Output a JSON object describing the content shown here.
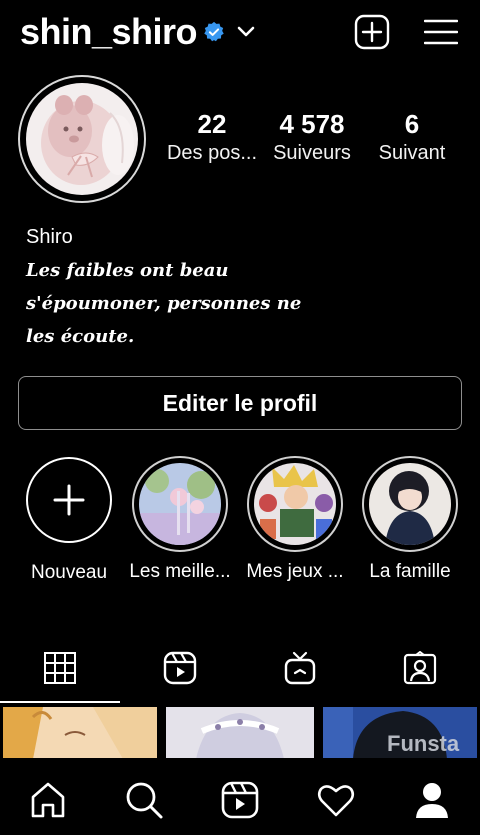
{
  "header": {
    "username": "shin_shiro",
    "icons": [
      "verified-badge-icon",
      "chevron-down-icon",
      "add-post-icon",
      "menu-icon"
    ]
  },
  "stats": [
    {
      "num": "22",
      "label": "Des pos..."
    },
    {
      "num": "4 578",
      "label": "Suiveurs"
    },
    {
      "num": "6",
      "label": "Suivant"
    }
  ],
  "profile": {
    "name": "Shiro",
    "bio_lines": [
      "Les faibles ont beau",
      "s'époumoner, personnes ne",
      "les écoute."
    ]
  },
  "edit_button": "Editer le profil",
  "highlights": [
    {
      "label": "Nouveau"
    },
    {
      "label": "Les meille..."
    },
    {
      "label": "Mes jeux ..."
    },
    {
      "label": "La famille"
    }
  ],
  "tabs": [
    "grid-icon",
    "reels-icon",
    "igtv-icon",
    "tagged-icon"
  ],
  "posts": {
    "watermark": "Funsta"
  },
  "nav": [
    "home-icon",
    "search-icon",
    "reels-icon",
    "heart-icon",
    "profile-icon"
  ],
  "colors": {
    "background": "#000000",
    "verified": "#3897f0",
    "border": "#8e8e8e"
  }
}
